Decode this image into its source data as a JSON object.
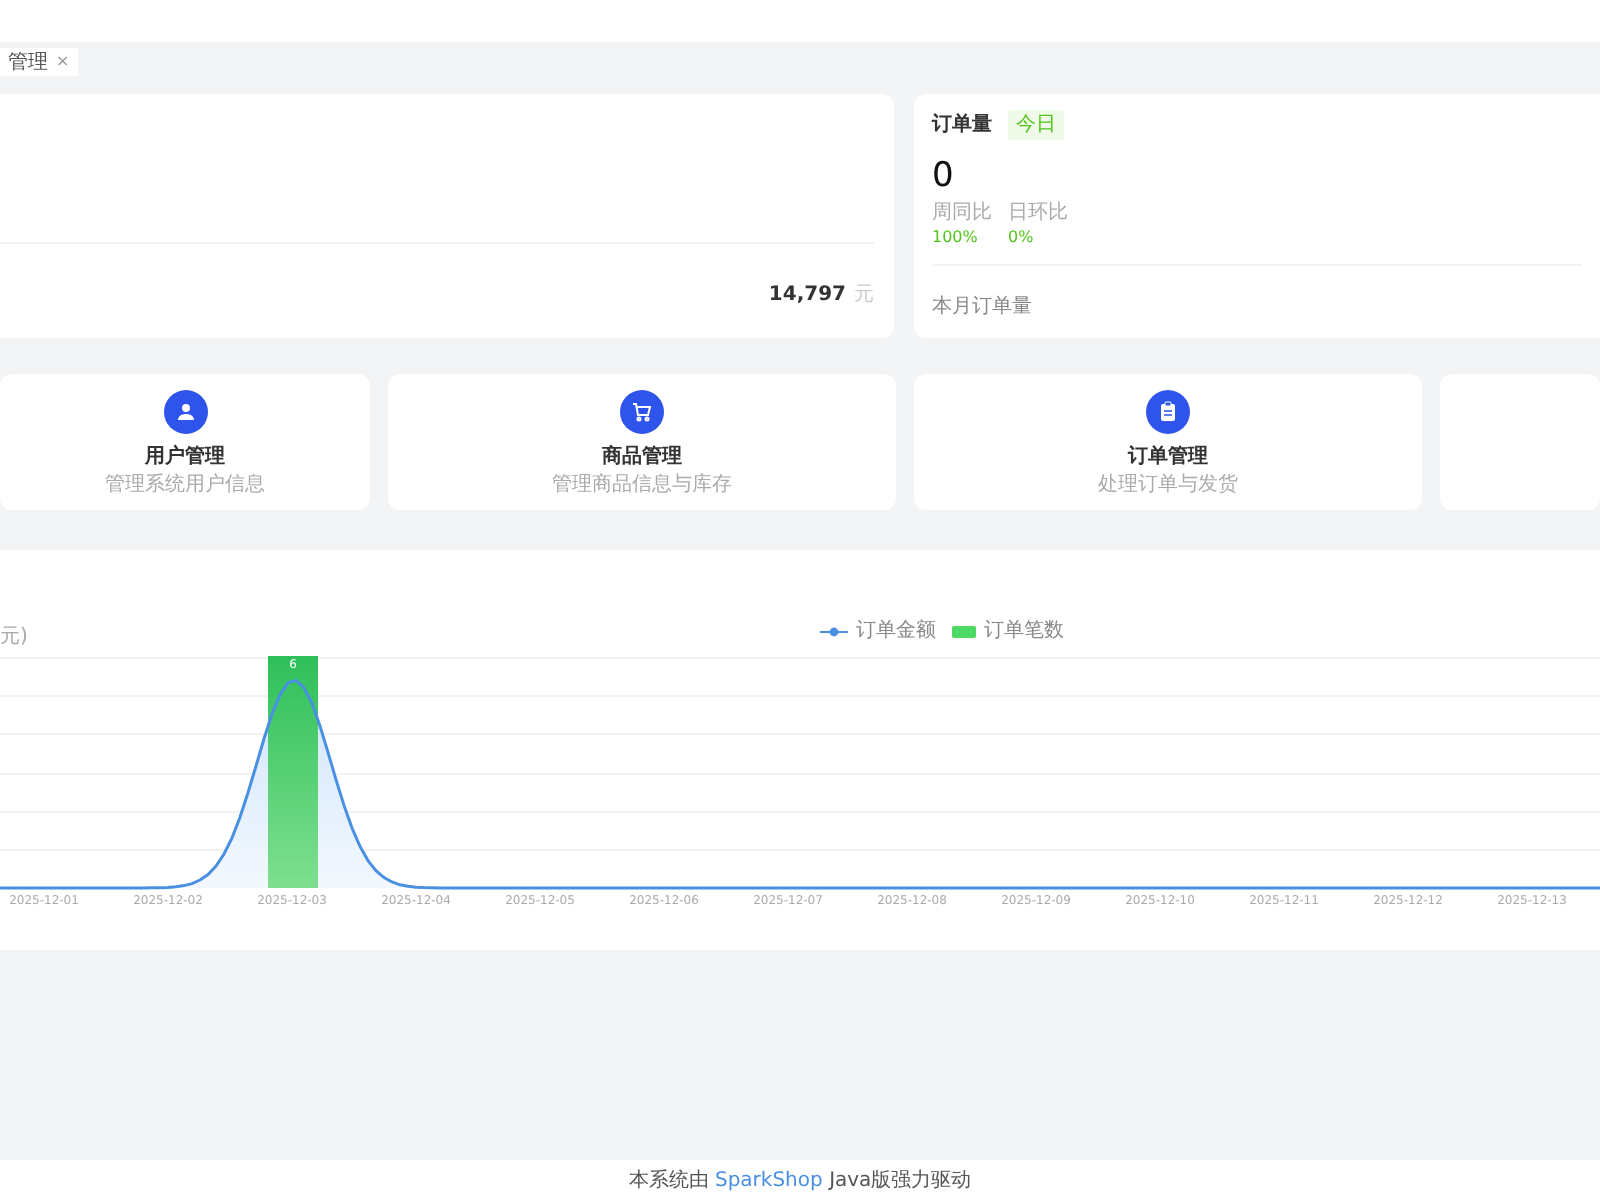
{
  "tabs": [
    {
      "label": "管理",
      "selected": true,
      "close": "×"
    }
  ],
  "sales_card": {
    "amount": "14,797",
    "unit": "元"
  },
  "order_card": {
    "title": "订单量",
    "badge": "今日",
    "value": "0",
    "stats": [
      {
        "label": "周同比",
        "value": "100%"
      },
      {
        "label": "日环比",
        "value": "0%"
      }
    ],
    "footer": "本月订单量"
  },
  "shortcuts": [
    {
      "kind": "user",
      "title": "用户管理",
      "subtitle": "管理系统用户信息"
    },
    {
      "kind": "cart",
      "title": "商品管理",
      "subtitle": "管理商品信息与库存"
    },
    {
      "kind": "order",
      "title": "订单管理",
      "subtitle": "处理订单与发货"
    },
    {
      "kind": "empty"
    }
  ],
  "chart": {
    "y_unit": "元)",
    "legend": [
      {
        "kind": "line",
        "label": "订单金额"
      },
      {
        "kind": "bar",
        "label": "订单笔数"
      }
    ],
    "bar_label": "6",
    "x_labels": [
      "2025-12-01",
      "2025-12-02",
      "2025-12-03",
      "2025-12-04",
      "2025-12-05",
      "2025-12-06",
      "2025-12-07",
      "2025-12-08",
      "2025-12-09",
      "2025-12-10",
      "2025-12-11",
      "2025-12-12",
      "2025-12-13"
    ]
  },
  "footer": {
    "prefix": "本系统由",
    "link": "SparkShop",
    "suffix": "Java版强力驱动"
  }
}
